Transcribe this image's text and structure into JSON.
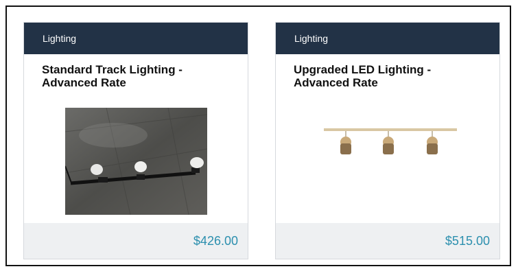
{
  "products": [
    {
      "category": "Lighting",
      "title": "Standard Track Lighting - Advanced Rate",
      "price": "$426.00",
      "image_icon": "track-lighting-photo"
    },
    {
      "category": "Lighting",
      "title": "Upgraded LED Lighting - Advanced Rate",
      "price": "$515.00",
      "image_icon": "led-track-lighting-photo"
    }
  ]
}
